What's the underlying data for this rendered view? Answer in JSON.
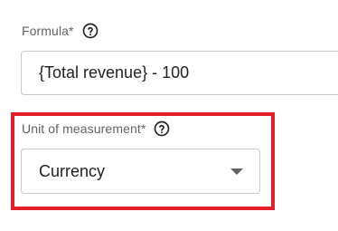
{
  "formula": {
    "label": "Formula*",
    "value": "{Total revenue} - 100"
  },
  "unit_of_measurement": {
    "label": "Unit of measurement*",
    "selected": "Currency"
  },
  "icons": {
    "help": "help-circle-icon",
    "dropdown": "caret-down-icon"
  },
  "colors": {
    "highlight": "#e3202a",
    "border": "#c7c9cc",
    "label": "#5f6368",
    "text": "#202124"
  }
}
